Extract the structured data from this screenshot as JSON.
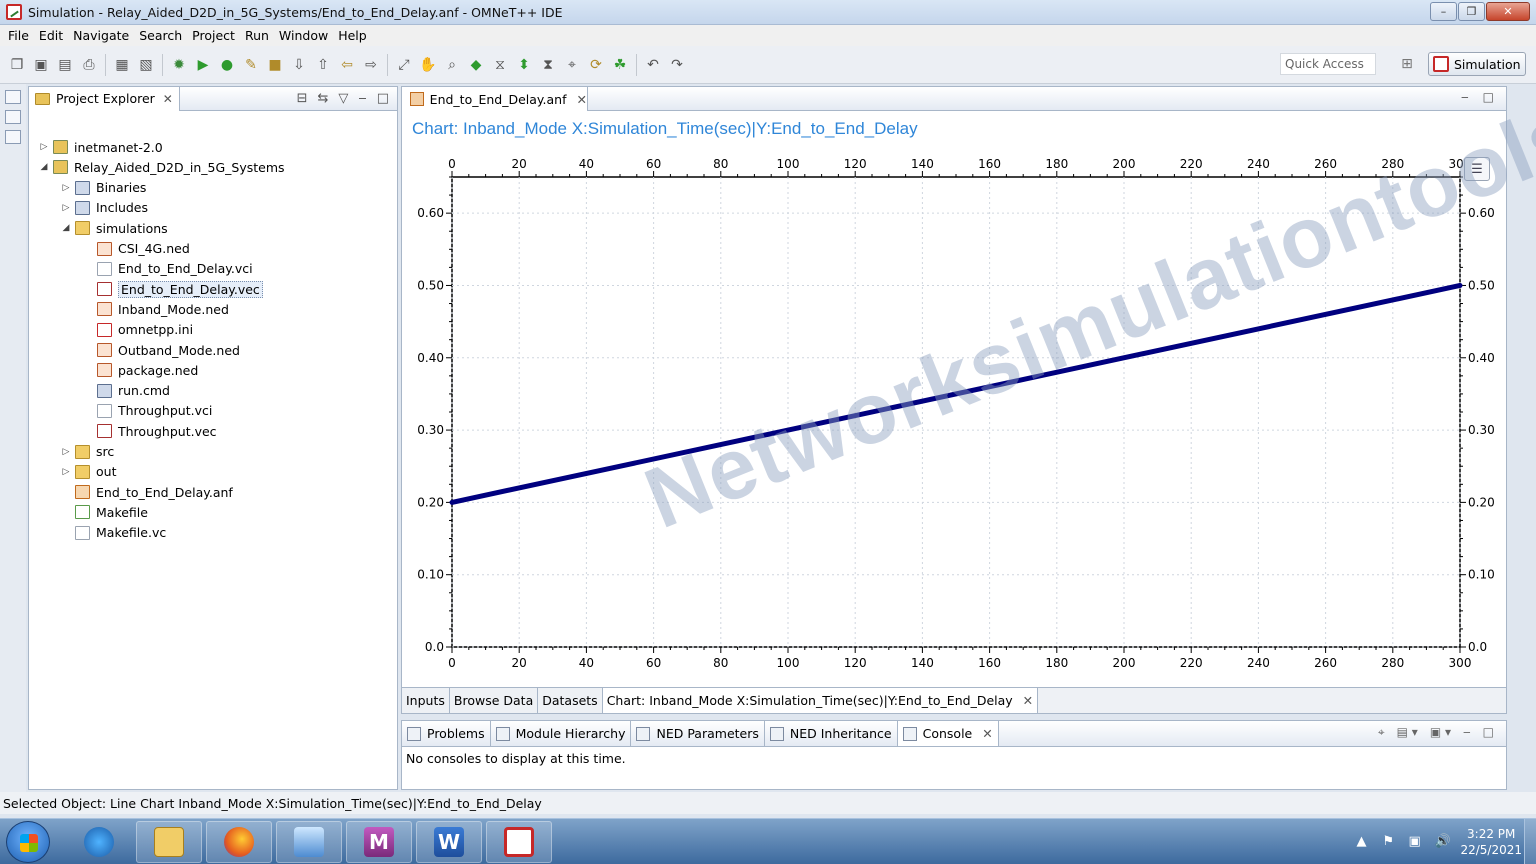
{
  "window": {
    "title": "Simulation - Relay_Aided_D2D_in_5G_Systems/End_to_End_Delay.anf - OMNeT++ IDE"
  },
  "menu": [
    "File",
    "Edit",
    "Navigate",
    "Search",
    "Project",
    "Run",
    "Window",
    "Help"
  ],
  "toolbar": {
    "quick_access_placeholder": "Quick Access",
    "perspective_label": "Simulation"
  },
  "explorer": {
    "tab_label": "Project Explorer",
    "items": [
      {
        "label": "inetmanet-2.0",
        "depth": 0,
        "twisty": "collapsed",
        "kind": "proj"
      },
      {
        "label": "Relay_Aided_D2D_in_5G_Systems",
        "depth": 0,
        "twisty": "expanded",
        "kind": "proj"
      },
      {
        "label": "Binaries",
        "depth": 1,
        "twisty": "collapsed",
        "kind": "lib"
      },
      {
        "label": "Includes",
        "depth": 1,
        "twisty": "collapsed",
        "kind": "lib"
      },
      {
        "label": "simulations",
        "depth": 1,
        "twisty": "expanded",
        "kind": "folder"
      },
      {
        "label": "CSI_4G.ned",
        "depth": 2,
        "twisty": "",
        "kind": "ned"
      },
      {
        "label": "End_to_End_Delay.vci",
        "depth": 2,
        "twisty": "",
        "kind": "doc"
      },
      {
        "label": "End_to_End_Delay.vec",
        "depth": 2,
        "twisty": "",
        "kind": "vec",
        "selected": true
      },
      {
        "label": "Inband_Mode.ned",
        "depth": 2,
        "twisty": "",
        "kind": "ned"
      },
      {
        "label": "omnetpp.ini",
        "depth": 2,
        "twisty": "",
        "kind": "ini"
      },
      {
        "label": "Outband_Mode.ned",
        "depth": 2,
        "twisty": "",
        "kind": "ned"
      },
      {
        "label": "package.ned",
        "depth": 2,
        "twisty": "",
        "kind": "ned"
      },
      {
        "label": "run.cmd",
        "depth": 2,
        "twisty": "",
        "kind": "lib"
      },
      {
        "label": "Throughput.vci",
        "depth": 2,
        "twisty": "",
        "kind": "doc"
      },
      {
        "label": "Throughput.vec",
        "depth": 2,
        "twisty": "",
        "kind": "vec"
      },
      {
        "label": "src",
        "depth": 1,
        "twisty": "collapsed",
        "kind": "folder"
      },
      {
        "label": "out",
        "depth": 1,
        "twisty": "collapsed",
        "kind": "folder"
      },
      {
        "label": "End_to_End_Delay.anf",
        "depth": 1,
        "twisty": "",
        "kind": "anf"
      },
      {
        "label": "Makefile",
        "depth": 1,
        "twisty": "",
        "kind": "mk"
      },
      {
        "label": "Makefile.vc",
        "depth": 1,
        "twisty": "",
        "kind": "doc"
      }
    ]
  },
  "editor": {
    "tab_label": "End_to_End_Delay.anf",
    "bottom_tabs": [
      "Inputs",
      "Browse Data",
      "Datasets",
      "Chart:  Inband_Mode  X:Simulation_Time(sec)|Y:End_to_End_Delay"
    ],
    "watermark": "Networksimulationtools.com"
  },
  "chart_data": {
    "type": "line",
    "title": "Chart:  Inband_Mode  X:Simulation_Time(sec)|Y:End_to_End_Delay",
    "xlim": [
      0,
      300
    ],
    "ylim": [
      0,
      0.65
    ],
    "x_ticks": [
      0,
      20,
      40,
      60,
      80,
      100,
      120,
      140,
      160,
      180,
      200,
      220,
      240,
      260,
      280,
      300
    ],
    "y_ticks": [
      "0.0",
      "0.10",
      "0.20",
      "0.30",
      "0.40",
      "0.50",
      "0.60"
    ],
    "y_tick_values": [
      0,
      0.1,
      0.2,
      0.3,
      0.4,
      0.5,
      0.6
    ],
    "series": [
      {
        "color": "#00007f",
        "x": [
          0,
          300
        ],
        "y": [
          0.2,
          0.5
        ]
      }
    ],
    "grid": true
  },
  "console": {
    "tabs": [
      "Problems",
      "Module Hierarchy",
      "NED Parameters",
      "NED Inheritance",
      "Console"
    ],
    "message": "No consoles to display at this time."
  },
  "status": {
    "text": "Selected Object: Line Chart  Inband_Mode  X:Simulation_Time(sec)|Y:End_to_End_Delay"
  },
  "taskbar": {
    "time": "3:22 PM",
    "date": "22/5/2021"
  }
}
